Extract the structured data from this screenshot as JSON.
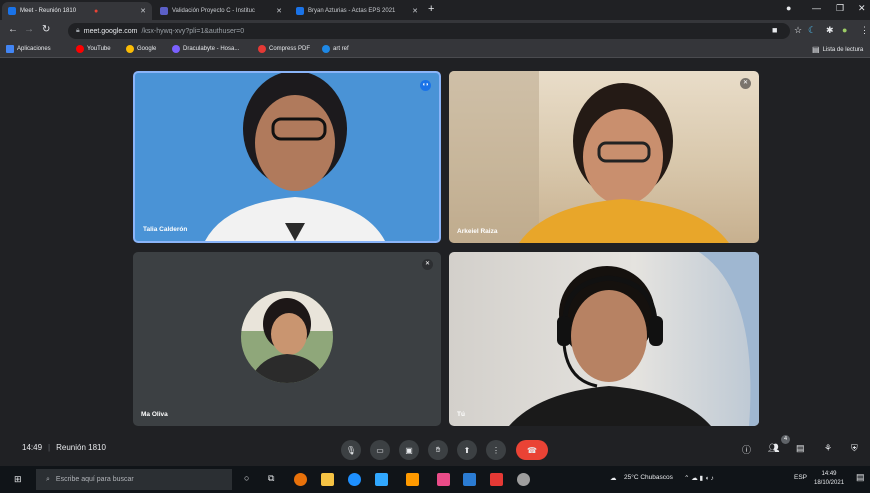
{
  "browser": {
    "tabs": [
      {
        "label": "Meet - Reunión 1810",
        "color": "#1a73e8",
        "active": true
      },
      {
        "label": "Validación Proyecto C - Instituc",
        "color": "#5b5fc7",
        "active": false
      },
      {
        "label": "Bryan Azturias - Actas EPS 2021",
        "color": "#1a73e8",
        "active": false
      }
    ],
    "url_host": "meet.google.com",
    "url_path": "/ksx-hywq-xvy?pli=1&authuser=0",
    "bookmarks": [
      {
        "label": "Aplicaciones",
        "color": "#4285f4"
      },
      {
        "label": "YouTube",
        "color": "#ff0000"
      },
      {
        "label": "Google",
        "color": "#fbbc05"
      },
      {
        "label": "Draculabyte - Hosa...",
        "color": "#7b61ff"
      },
      {
        "label": "Compress PDF",
        "color": "#e53935"
      },
      {
        "label": "art ref",
        "color": "#1e88e5"
      }
    ],
    "reading_list": "Lista de lectura"
  },
  "meet": {
    "participants": [
      {
        "name": "Talia Calderón",
        "skin": "#b07a5c",
        "hair": "#1c1a1d",
        "shirt": "#f2f2f2"
      },
      {
        "name": "Arkeiel Raiza",
        "skin": "#c98f6e",
        "hair": "#241a15",
        "shirt": "#e8a62a"
      },
      {
        "name": "Ma Oliva",
        "skin": "#c99570",
        "hair": "#1d1717",
        "shirt": "#2b2b2b"
      },
      {
        "name": "Tú",
        "skin": "#b78263",
        "hair": "#15110e",
        "shirt": "#1a1a1a"
      }
    ],
    "time": "14:49",
    "meeting_name": "Reunión 1810",
    "people_count": "4",
    "hangup_color": "#ea4335"
  },
  "taskbar": {
    "search_placeholder": "Escribe aquí para buscar",
    "weather": "25°C Chubascos",
    "language": "ESP",
    "clock_time": "14:49",
    "clock_date": "18/10/2021"
  }
}
